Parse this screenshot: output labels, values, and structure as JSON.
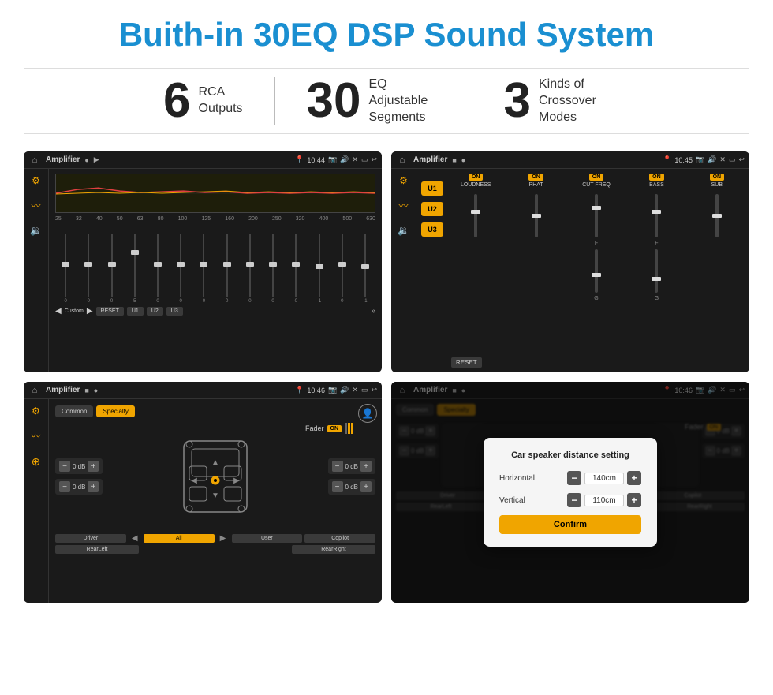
{
  "page": {
    "title": "Buith-in 30EQ DSP Sound System"
  },
  "stats": [
    {
      "number": "6",
      "desc_line1": "RCA",
      "desc_line2": "Outputs"
    },
    {
      "number": "30",
      "desc_line1": "EQ Adjustable",
      "desc_line2": "Segments"
    },
    {
      "number": "3",
      "desc_line1": "Kinds of",
      "desc_line2": "Crossover Modes"
    }
  ],
  "screens": {
    "eq": {
      "topbar": {
        "title": "Amplifier",
        "time": "10:44"
      },
      "freqs": [
        "25",
        "32",
        "40",
        "50",
        "63",
        "80",
        "100",
        "125",
        "160",
        "200",
        "250",
        "320",
        "400",
        "500",
        "630"
      ],
      "values": [
        "0",
        "0",
        "0",
        "5",
        "0",
        "0",
        "0",
        "0",
        "0",
        "0",
        "0",
        "-1",
        "0",
        "-1"
      ],
      "bottomButtons": [
        "Custom",
        "RESET",
        "U1",
        "U2",
        "U3"
      ]
    },
    "crossover": {
      "topbar": {
        "title": "Amplifier",
        "time": "10:45"
      },
      "uButtons": [
        "U1",
        "U2",
        "U3"
      ],
      "controls": [
        "LOUDNESS",
        "PHAT",
        "CUT FREQ",
        "BASS",
        "SUB"
      ],
      "resetLabel": "RESET"
    },
    "fader": {
      "topbar": {
        "title": "Amplifier",
        "time": "10:46"
      },
      "tabs": [
        "Common",
        "Specialty"
      ],
      "activeTab": "Specialty",
      "faderLabel": "Fader",
      "onLabel": "ON",
      "volumeControls": {
        "leftTop": "0 dB",
        "leftBottom": "0 dB",
        "rightTop": "0 dB",
        "rightBottom": "0 dB"
      },
      "bottomButtons": [
        "Driver",
        "",
        "All",
        "",
        "User",
        "RearRight",
        "RearLeft",
        "Copilot"
      ]
    },
    "distance": {
      "topbar": {
        "title": "Amplifier",
        "time": "10:46"
      },
      "tabs": [
        "Common",
        "Specialty"
      ],
      "modal": {
        "title": "Car speaker distance setting",
        "horizontal_label": "Horizontal",
        "horizontal_value": "140cm",
        "vertical_label": "Vertical",
        "vertical_value": "110cm",
        "confirm_label": "Confirm"
      }
    }
  }
}
